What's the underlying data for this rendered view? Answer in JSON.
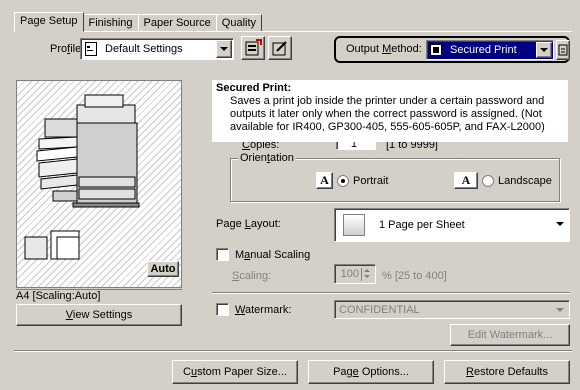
{
  "tabs": [
    "Page Setup",
    "Finishing",
    "Paper Source",
    "Quality"
  ],
  "profile": {
    "label": "Profile:",
    "value": "Default Settings"
  },
  "output_method": {
    "label": "Output Method:",
    "value": "Secured Print"
  },
  "tooltip": {
    "title": "Secured Print:",
    "lines": [
      "Saves a print job inside the printer under a certain password and",
      "outputs it later only when the correct password is assigned. (Not",
      "available for IR400, GP300-405, 555-605-605P, and FAX-L2000)"
    ]
  },
  "copies": {
    "label": "Copies:",
    "value": "1",
    "range": "[1 to 9999]"
  },
  "orientation": {
    "title": "Orientation",
    "portrait": "Portrait",
    "landscape": "Landscape",
    "selected": "Portrait"
  },
  "page_layout": {
    "label": "Page Layout:",
    "value": "1 Page per Sheet"
  },
  "manual_scaling": {
    "label": "Manual Scaling",
    "checked": false
  },
  "scaling": {
    "label": "Scaling:",
    "value": "100",
    "range": "% [25 to 400]"
  },
  "watermark": {
    "label": "Watermark:",
    "value": "CONFIDENTIAL",
    "checked": false
  },
  "edit_watermark": "Edit Watermark...",
  "preview": {
    "auto_badge": "Auto",
    "status": "A4 [Scaling:Auto]"
  },
  "view_settings": "View Settings",
  "buttons": {
    "custom_paper": "Custom Paper Size...",
    "page_options": "Page Options...",
    "restore_defaults": "Restore Defaults"
  }
}
